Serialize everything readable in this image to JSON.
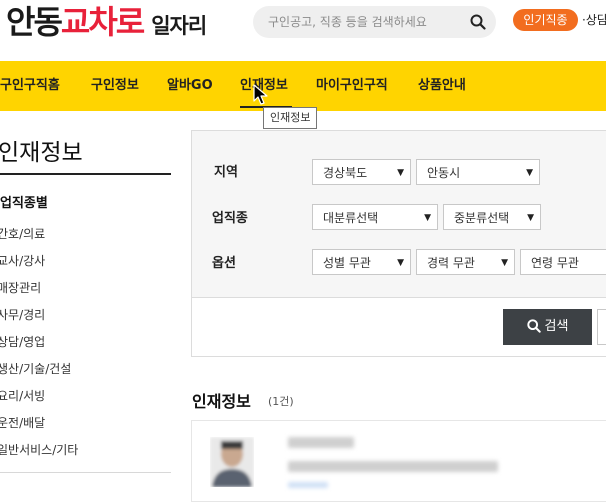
{
  "header": {
    "logo": {
      "part1": "안동",
      "part2": "교차로",
      "part3": "일자리"
    },
    "search": {
      "placeholder": "구인공고, 직종 등을 검색하세요"
    },
    "popular_badge": "인기직종",
    "popular_text": "·상담"
  },
  "nav": {
    "items": [
      "구인구직홈",
      "구인정보",
      "알바GO",
      "인재정보",
      "마이구인구직",
      "상품안내"
    ],
    "active": "인재정보",
    "tooltip": "인재정보"
  },
  "sidebar": {
    "title": "인재정보",
    "category_title": "업직종별",
    "items": [
      "간호/의료",
      "교사/강사",
      "매장관리",
      "사무/경리",
      "상담/영업",
      "생산/기술/건설",
      "요리/서빙",
      "운전/배달",
      "일반서비스/기타"
    ]
  },
  "filters": {
    "region_label": "지역",
    "region_province": "경상북도",
    "region_city": "안동시",
    "job_label": "업직종",
    "job_major": "대분류선택",
    "job_middle": "중분류선택",
    "option_label": "옵션",
    "gender": "성별 무관",
    "career": "경력 무관",
    "age": "연령 무관",
    "search_button": "검색"
  },
  "results": {
    "title": "인재정보",
    "count": "(1건)"
  },
  "colors": {
    "nav_bg": "#ffd400",
    "brand_red": "#e8213a",
    "badge_orange": "#f26d1f",
    "button_dark": "#3d4145"
  }
}
